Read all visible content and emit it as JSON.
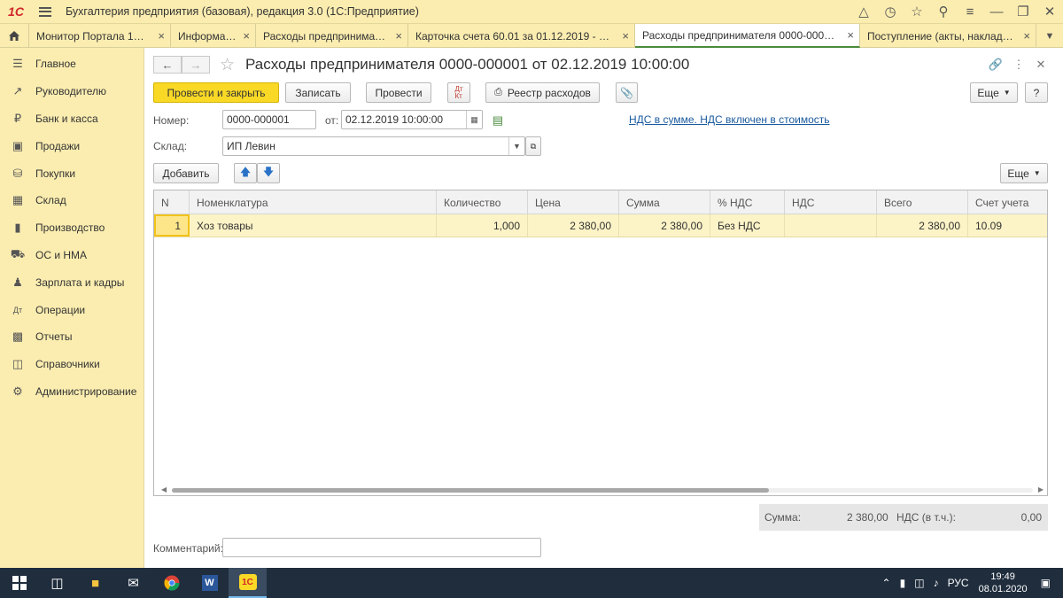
{
  "titlebar": {
    "logo": "1С",
    "title": "Бухгалтерия предприятия (базовая), редакция 3.0  (1С:Предприятие)",
    "icons": [
      "bell-icon",
      "history-icon",
      "star-icon",
      "search-icon",
      "settings-icon",
      "minimize-icon",
      "restore-icon",
      "close-icon"
    ]
  },
  "tabs": [
    {
      "label": "Монитор Портала 1С:ИТС"
    },
    {
      "label": "Информация"
    },
    {
      "label": "Расходы предпринимателя"
    },
    {
      "label": "Карточка счета 60.01 за 01.12.2019 - 06...."
    },
    {
      "label": "Расходы предпринимателя 0000-000001...",
      "active": true
    },
    {
      "label": "Поступление (акты, накладные)"
    }
  ],
  "sidebar": {
    "items": [
      {
        "label": "Главное",
        "icon": "menu-lines-icon"
      },
      {
        "label": "Руководителю",
        "icon": "trend-icon"
      },
      {
        "label": "Банк и касса",
        "icon": "ruble-icon"
      },
      {
        "label": "Продажи",
        "icon": "bag-icon"
      },
      {
        "label": "Покупки",
        "icon": "cart-icon"
      },
      {
        "label": "Склад",
        "icon": "warehouse-icon"
      },
      {
        "label": "Производство",
        "icon": "factory-icon"
      },
      {
        "label": "ОС и НМА",
        "icon": "truck-icon"
      },
      {
        "label": "Зарплата и кадры",
        "icon": "person-icon"
      },
      {
        "label": "Операции",
        "icon": "dt-kt-icon"
      },
      {
        "label": "Отчеты",
        "icon": "bar-chart-icon"
      },
      {
        "label": "Справочники",
        "icon": "book-icon"
      },
      {
        "label": "Администрирование",
        "icon": "gear-icon"
      }
    ]
  },
  "form": {
    "title": "Расходы предпринимателя 0000-000001 от 02.12.2019 10:00:00",
    "toolbar": {
      "post_close": "Провести и закрыть",
      "save": "Записать",
      "post": "Провести",
      "dtkt": "Дт/Кт",
      "registry": "Реестр расходов",
      "more": "Еще",
      "help": "?"
    },
    "number_label": "Номер:",
    "number_value": "0000-000001",
    "date_label": "от:",
    "date_value": "02.12.2019 10:00:00",
    "vat_link": "НДС в сумме. НДС включен в стоимость",
    "warehouse_label": "Склад:",
    "warehouse_value": "ИП Левин",
    "add_button": "Добавить",
    "table_more": "Еще"
  },
  "table": {
    "columns": [
      "N",
      "Номенклатура",
      "Количество",
      "Цена",
      "Сумма",
      "% НДС",
      "НДС",
      "Всего",
      "Счет учета"
    ],
    "rows": [
      [
        "1",
        "Хоз товары",
        "1,000",
        "2 380,00",
        "2 380,00",
        "Без НДС",
        "",
        "2 380,00",
        "10.09"
      ]
    ]
  },
  "totals": {
    "sum_label": "Сумма:",
    "sum_value": "2 380,00",
    "vat_label": "НДС (в т.ч.):",
    "vat_value": "0,00"
  },
  "comment_label": "Комментарий:",
  "comment_value": "",
  "taskbar": {
    "lang": "РУС",
    "time": "19:49",
    "date": "08.01.2020"
  }
}
